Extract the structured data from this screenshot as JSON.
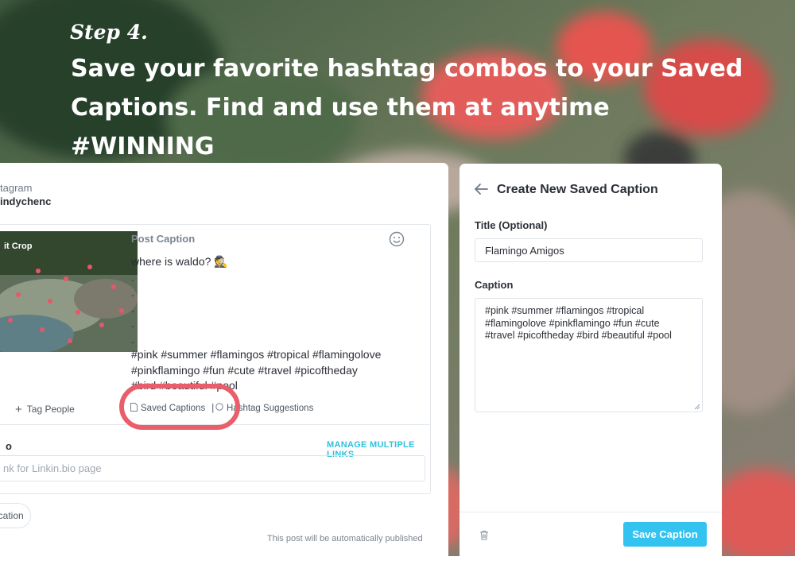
{
  "header": {
    "step": "Step 4.",
    "headline": "Save your favorite hashtag combos to your Saved Captions. Find and use them at anytime #WINNING"
  },
  "post_editor": {
    "account_label": "tagram",
    "account_name": "indychenc",
    "crop_label": "it Crop",
    "caption_label": "Post Caption",
    "caption_lines": [
      "where is waldo? 🕵️",
      ".",
      ".",
      ".",
      ".",
      ".",
      "#pink #summer #flamingos #tropical #flamingolove",
      "#pinkflamingo #fun #cute #travel #picoftheday",
      "#bird #beautiful #pool"
    ],
    "tag_people": "Tag People",
    "saved_captions": "Saved Captions",
    "separator": "|",
    "hashtag_suggestions": "Hashtag Suggestions",
    "link_label": "o",
    "manage_links": "MANAGE MULTIPLE LINKS",
    "link_placeholder": "nk for Linkin.bio page",
    "location_button": "ocation",
    "publish_note": "This post will be automatically published"
  },
  "saved_caption_panel": {
    "title": "Create New Saved Caption",
    "title_field_label": "Title (Optional)",
    "title_field_value": "Flamingo Amigos",
    "caption_field_label": "Caption",
    "caption_lines": [
      "#pink #summer #flamingos #tropical",
      "#flamingolove #pinkflamingo #fun #cute",
      "#travel #picoftheday #bird #beautiful #pool"
    ],
    "save_button": "Save Caption"
  },
  "colors": {
    "highlight": "#ea5d6a",
    "accent": "#33c3f0",
    "link_accent": "#2ec1dd"
  }
}
